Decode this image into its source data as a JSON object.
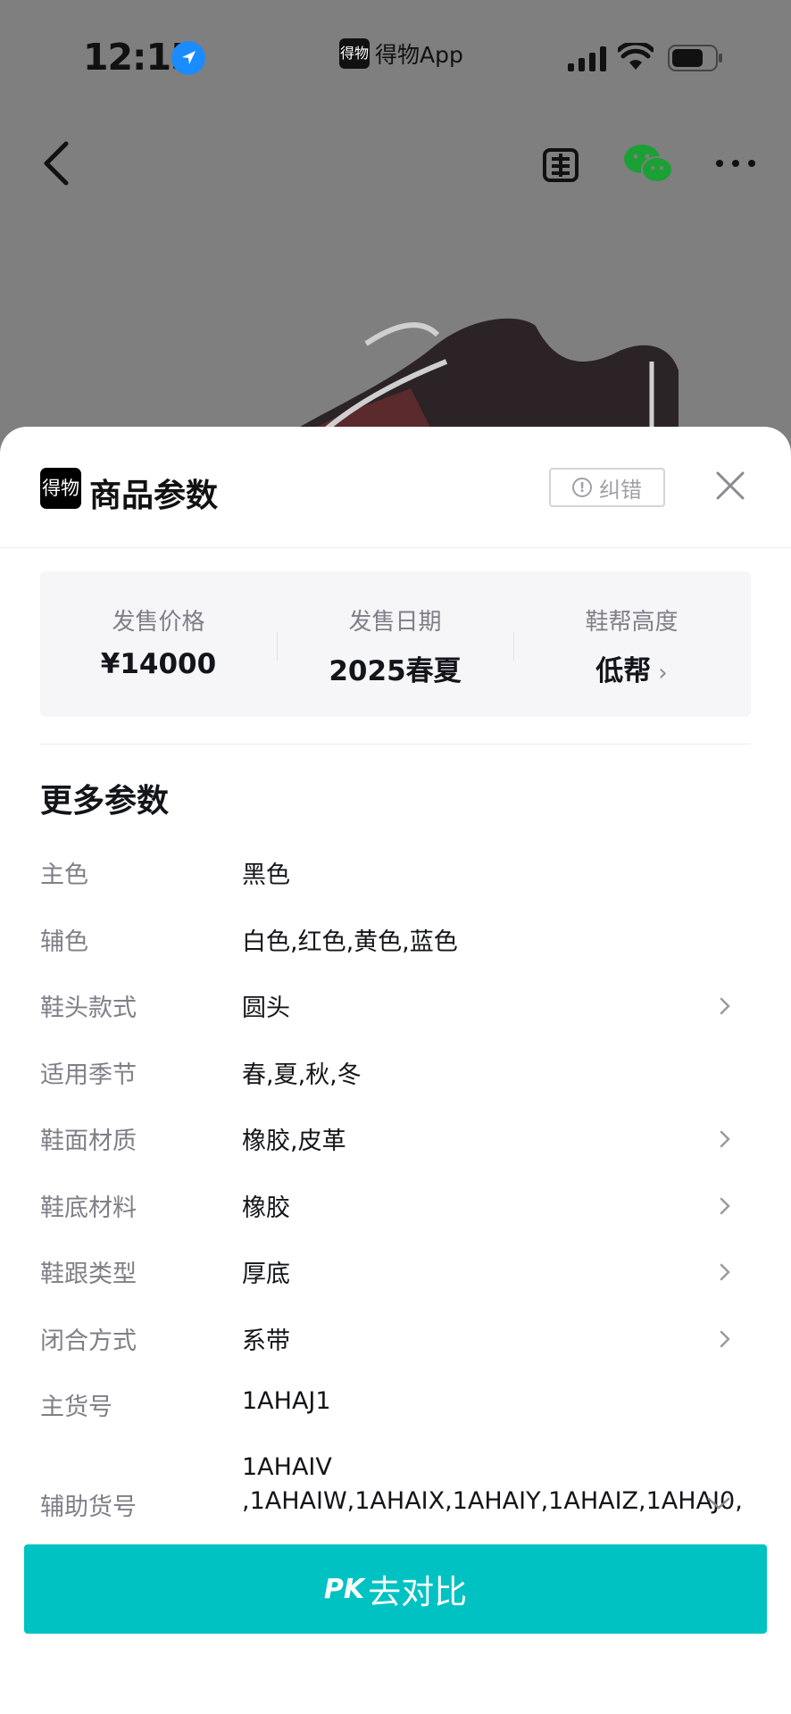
{
  "status_bar": {
    "time": "12:15",
    "app_name": "得物App",
    "app_logo_text": "得物"
  },
  "nav": {
    "sell_icon": "sell-icon",
    "share_icon": "wechat-icon",
    "more_icon": "more-icon",
    "back_icon": "back-icon"
  },
  "sheet": {
    "logo_text": "得物",
    "title": "商品参数",
    "error_label": "纠错",
    "summary": [
      {
        "label": "发售价格",
        "value": "¥14000"
      },
      {
        "label": "发售日期",
        "value": "2025春夏"
      },
      {
        "label": "鞋帮高度",
        "value": "低帮",
        "chevron": "›"
      }
    ],
    "more_title": "更多参数",
    "params": [
      {
        "key": "主色",
        "value": "黑色",
        "arrow": false
      },
      {
        "key": "辅色",
        "value": "白色,红色,黄色,蓝色",
        "arrow": false
      },
      {
        "key": "鞋头款式",
        "value": "圆头",
        "arrow": true
      },
      {
        "key": "适用季节",
        "value": "春,夏,秋,冬",
        "arrow": false
      },
      {
        "key": "鞋面材质",
        "value": "橡胶,皮革",
        "arrow": true
      },
      {
        "key": "鞋底材料",
        "value": "橡胶",
        "arrow": true
      },
      {
        "key": "鞋跟类型",
        "value": "厚底",
        "arrow": true
      },
      {
        "key": "闭合方式",
        "value": "系带",
        "arrow": true
      },
      {
        "key": "主货号",
        "value": "1AHAJ1",
        "arrow": false
      }
    ],
    "aux_sku": {
      "key": "辅助货号",
      "line1": "1AHAIV",
      "line2": ",1AHAIW,1AHAIX,1AHAIY,1AHAIZ,1AHAJ0,"
    },
    "pk_button": {
      "pk": "PK",
      "label": "去对比"
    }
  },
  "colors": {
    "accent": "#01c2c3",
    "overlay": "#7f7f7f",
    "text": "#14151a",
    "muted": "#7f7f88"
  }
}
